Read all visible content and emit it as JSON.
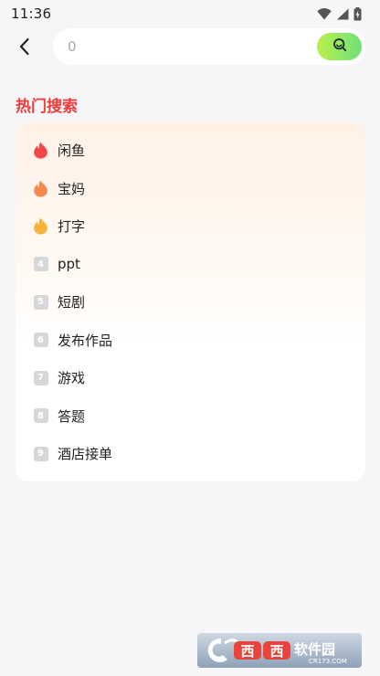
{
  "status_bar": {
    "time": "11:36",
    "icons": [
      "wifi-icon",
      "signal-icon",
      "battery-icon"
    ]
  },
  "search": {
    "value": "0",
    "button_icon": "search-icon"
  },
  "hot_search": {
    "title": "热门搜索",
    "items": [
      {
        "rank": "1",
        "label": "闲鱼",
        "flame_color": "#f04848"
      },
      {
        "rank": "2",
        "label": "宝妈",
        "flame_color": "#f48a52"
      },
      {
        "rank": "3",
        "label": "打字",
        "flame_color": "#f6b23a"
      },
      {
        "rank": "4",
        "label": "ppt"
      },
      {
        "rank": "5",
        "label": "短剧"
      },
      {
        "rank": "6",
        "label": "发布作品"
      },
      {
        "rank": "7",
        "label": "游戏"
      },
      {
        "rank": "8",
        "label": "答题"
      },
      {
        "rank": "9",
        "label": "酒店接单"
      }
    ]
  },
  "watermark": {
    "brand": "西西软件园",
    "domain": "CR173.COM"
  },
  "colors": {
    "title_red": "#ef3b3b",
    "search_gradient_start": "#b9f04a",
    "search_gradient_end": "#6fe07a",
    "rank_grey": "#d7d7d9",
    "background": "#f6f5f8"
  }
}
